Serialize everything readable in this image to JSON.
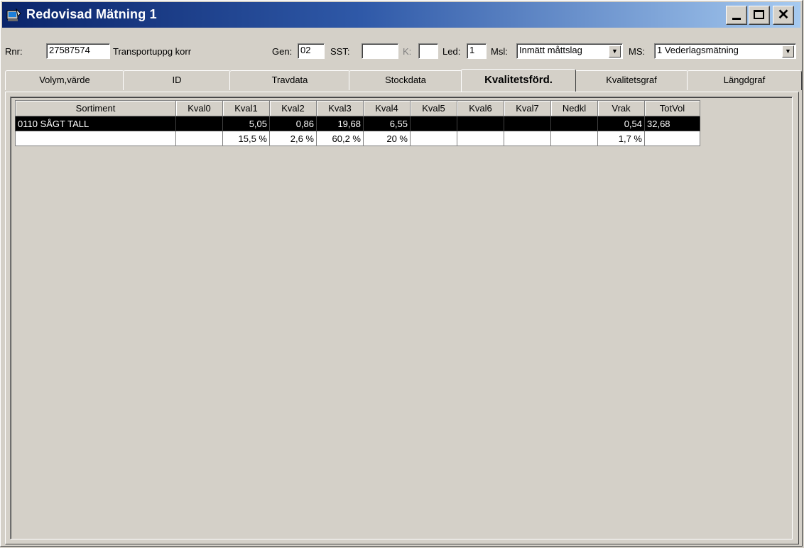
{
  "window": {
    "title": "Redovisad Mätning  1",
    "min_glyph": "",
    "close_glyph": "✕"
  },
  "toolbar": {
    "rnr_label": "Rnr:",
    "rnr_value": "27587574",
    "transport_text": "Transportuppg korr",
    "gen_label": "Gen:",
    "gen_value": "02",
    "sst_label": "SST:",
    "sst_value": "",
    "k_label": "K:",
    "k_value": "",
    "led_label": "Led:",
    "led_value": "1",
    "msl_label": "Msl:",
    "msl_value": "Inmätt måttslag",
    "ms_label": "MS:",
    "ms_value": "1 Vederlagsmätning"
  },
  "tabs": [
    {
      "label": "Volym,värde"
    },
    {
      "label": "ID"
    },
    {
      "label": "Travdata"
    },
    {
      "label": "Stockdata"
    },
    {
      "label": "Kvalitetsförd."
    },
    {
      "label": "Kvalitetsgraf"
    },
    {
      "label": "Längdgraf"
    }
  ],
  "active_tab": "Kvalitetsförd.",
  "grid": {
    "columns": [
      "Sortiment",
      "Kval0",
      "Kval1",
      "Kval2",
      "Kval3",
      "Kval4",
      "Kval5",
      "Kval6",
      "Kval7",
      "Nedkl",
      "Vrak",
      "TotVol"
    ],
    "rows": [
      [
        "0110 SÅGT    TALL",
        "",
        "5,05",
        "0,86",
        "19,68",
        "6,55",
        "",
        "",
        "",
        "",
        "0,54",
        "32,68"
      ],
      [
        "",
        "",
        "15,5 %",
        "2,6 %",
        "60,2 %",
        "20 %",
        "",
        "",
        "",
        "",
        "1,7 %",
        ""
      ]
    ]
  },
  "colors": {
    "titlebar_start": "#0a246a",
    "titlebar_end": "#a6caf0",
    "face": "#d4d0c8",
    "selected_row": "#000000"
  }
}
